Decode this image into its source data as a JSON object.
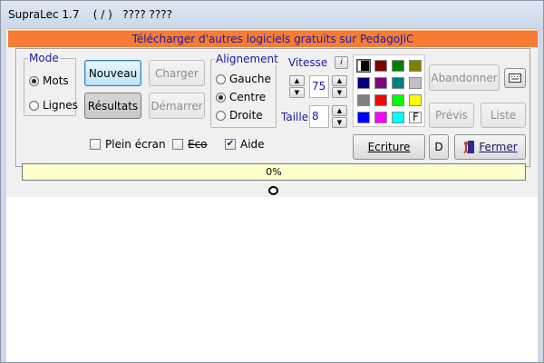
{
  "window": {
    "title": "SupraLec 1.7    ( / )   ???? ????"
  },
  "banner": {
    "text": "Télécharger d'autres logiciels gratuits sur PedagoJiC"
  },
  "mode": {
    "legend": "Mode",
    "options": [
      {
        "label": "Mots",
        "selected": true
      },
      {
        "label": "Lignes",
        "selected": false
      }
    ]
  },
  "buttons": {
    "nouveau": "Nouveau",
    "resultats": "Résultats",
    "charger": "Charger",
    "demarrer": "Démarrer",
    "abandonner": "Abandonner",
    "previs": "Prévis",
    "liste": "Liste",
    "ecriture": "Ecriture",
    "d": "D",
    "fermer": "Fermer"
  },
  "alignement": {
    "legend": "Alignement",
    "options": [
      {
        "label": "Gauche",
        "selected": false
      },
      {
        "label": "Centre",
        "selected": true
      },
      {
        "label": "Droite",
        "selected": false
      }
    ]
  },
  "vitesse": {
    "label": "Vitesse",
    "value": "75",
    "help": "i"
  },
  "taille": {
    "label": "Taille",
    "value": "8"
  },
  "palette": {
    "colors": [
      "#000000",
      "#800000",
      "#008000",
      "#808000",
      "#000080",
      "#800080",
      "#008080",
      "#c0c0c0",
      "#808080",
      "#ff0000",
      "#00ff00",
      "#ffff00",
      "#0000ff",
      "#ff00ff",
      "#00ffff",
      "#ffffff"
    ],
    "last_label": "F"
  },
  "options": {
    "plein_ecran": {
      "label": "Plein écran",
      "checked": false
    },
    "eco": {
      "label": "Eco",
      "checked": false
    },
    "aide": {
      "label": "Aide",
      "checked": true
    }
  },
  "progress": {
    "text": "0%",
    "value": 0
  }
}
